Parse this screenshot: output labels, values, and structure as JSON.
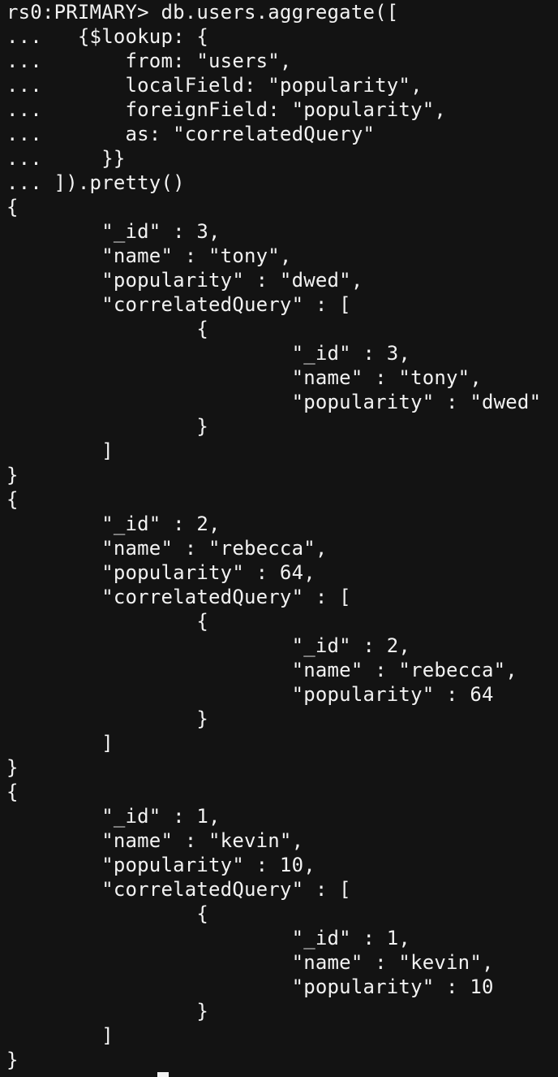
{
  "terminal": {
    "lines": [
      "rs0:PRIMARY> db.users.aggregate([",
      "...   {$lookup: {",
      "...       from: \"users\",",
      "...       localField: \"popularity\",",
      "...       foreignField: \"popularity\",",
      "...       as: \"correlatedQuery\"",
      "...     }}",
      "... ]).pretty()",
      "{",
      "        \"_id\" : 3,",
      "        \"name\" : \"tony\",",
      "        \"popularity\" : \"dwed\",",
      "        \"correlatedQuery\" : [",
      "                {",
      "                        \"_id\" : 3,",
      "                        \"name\" : \"tony\",",
      "                        \"popularity\" : \"dwed\"",
      "                }",
      "        ]",
      "}",
      "{",
      "        \"_id\" : 2,",
      "        \"name\" : \"rebecca\",",
      "        \"popularity\" : 64,",
      "        \"correlatedQuery\" : [",
      "                {",
      "                        \"_id\" : 2,",
      "                        \"name\" : \"rebecca\",",
      "                        \"popularity\" : 64",
      "                }",
      "        ]",
      "}",
      "{",
      "        \"_id\" : 1,",
      "        \"name\" : \"kevin\",",
      "        \"popularity\" : 10,",
      "        \"correlatedQuery\" : [",
      "                {",
      "                        \"_id\" : 1,",
      "                        \"name\" : \"kevin\",",
      "                        \"popularity\" : 10",
      "                }",
      "        ]",
      "}"
    ]
  }
}
